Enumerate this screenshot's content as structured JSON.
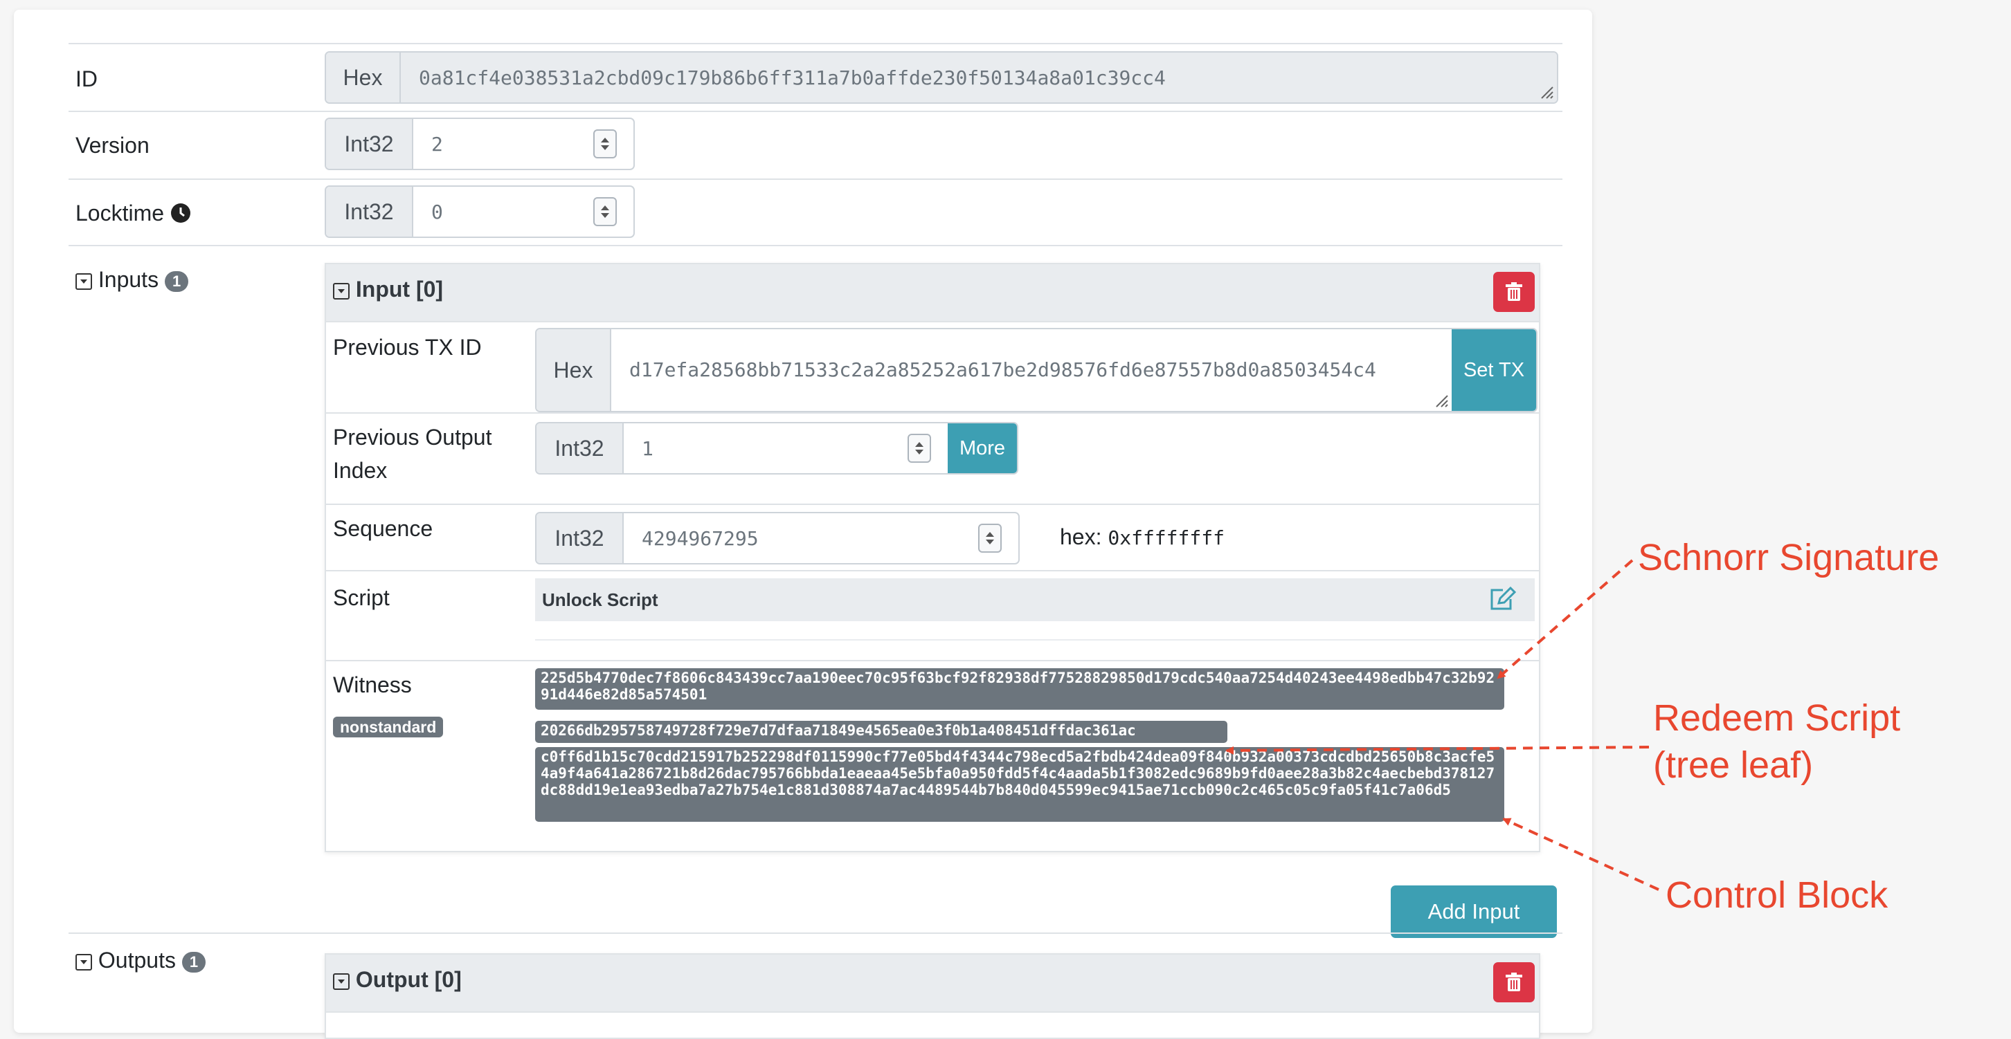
{
  "id_row": {
    "label": "ID",
    "prefix": "Hex",
    "value": "0a81cf4e038531a2cbd09c179b86b6ff311a7b0affde230f50134a8a01c39cc4"
  },
  "version_row": {
    "label": "Version",
    "prefix": "Int32",
    "value": "2"
  },
  "locktime_row": {
    "label": "Locktime",
    "prefix": "Int32",
    "value": "0"
  },
  "inputs": {
    "label": "Inputs",
    "count": "1",
    "add_button": "Add Input",
    "card": {
      "title": "Input [0]",
      "prev_txid": {
        "label": "Previous TX ID",
        "prefix": "Hex",
        "value": "d17efa28568bb71533c2a2a85252a617be2d98576fd6e87557b8d0a8503454c4",
        "button": "Set TX"
      },
      "prev_output_index": {
        "label": "Previous Output Index",
        "prefix": "Int32",
        "value": "1",
        "button": "More"
      },
      "sequence": {
        "label": "Sequence",
        "prefix": "Int32",
        "value": "4294967295",
        "hex_label": "hex:",
        "hex_value": "0xffffffff"
      },
      "script": {
        "label": "Script",
        "header": "Unlock Script"
      },
      "witness": {
        "label": "Witness",
        "badge": "nonstandard",
        "items": [
          "225d5b4770dec7f8606c843439cc7aa190eec70c95f63bcf92f82938df77528829850d179cdc540aa7254d40243ee4498edbb47c32b9291d446e82d85a574501",
          "20266db295758749728f729e7d7dfaa71849e4565ea0e3f0b1a408451dffdac361ac",
          "c0ff6d1b15c70cdd215917b252298df0115990cf77e05bd4f4344c798ecd5a2fbdb424dea09f840b932a00373cdcdbd25650b8c3acfe54a9f4a641a286721b8d26dac795766bbda1eaeaa45e5bfa0a950fdd5f4c4aada5b1f3082edc9689b9fd0aee28a3b82c4aecbebd378127dc88dd19e1ea93edba7a27b754e1c881d308874a7ac4489544b7b840d045599ec9415ae71ccb090c2c465c05c9fa05f41c7a06d5"
        ]
      }
    }
  },
  "outputs": {
    "label": "Outputs",
    "count": "1",
    "card": {
      "title": "Output [0]"
    }
  },
  "annotations": {
    "schnorr": "Schnorr Signature",
    "redeem_line1": "Redeem Script",
    "redeem_line2": "(tree leaf)",
    "control": "Control Block"
  },
  "colors": {
    "accent": "#3d9fb3",
    "danger": "#dc3545",
    "annotation": "#e8472f",
    "badge": "#6c757d"
  }
}
